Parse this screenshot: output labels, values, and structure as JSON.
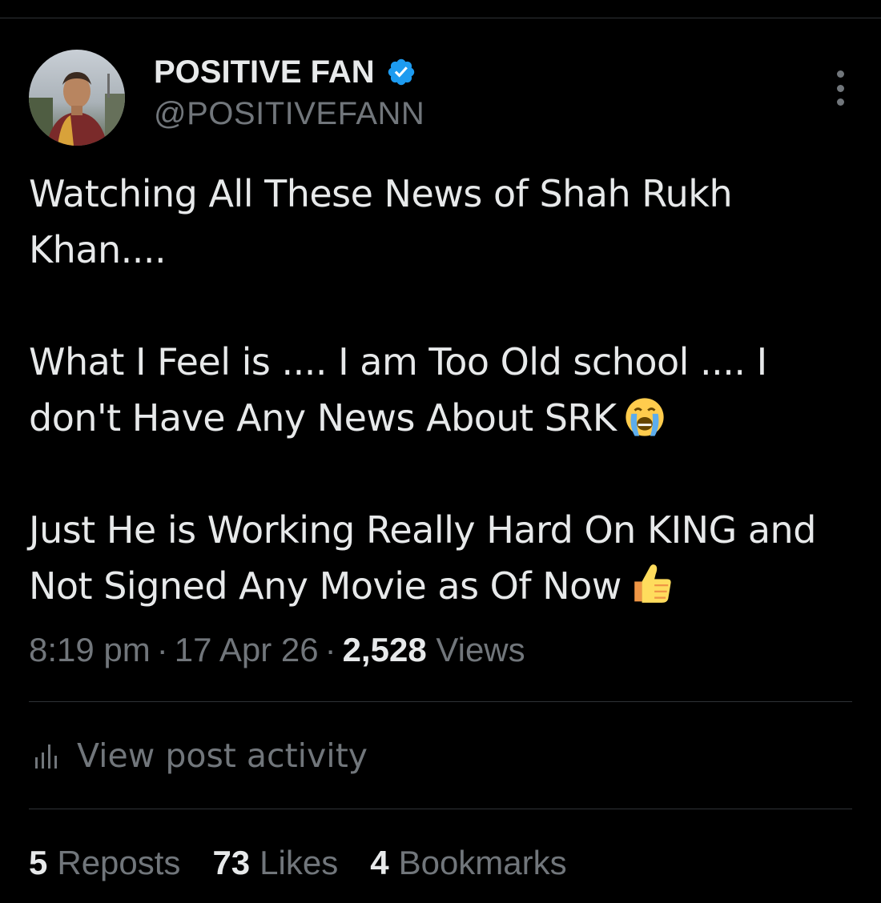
{
  "author": {
    "display_name": "POSITIVE FAN",
    "handle": "@POSITIVEFANN",
    "verified": true,
    "verified_color": "#1d9bf0"
  },
  "tweet": {
    "paragraphs": [
      {
        "text": "Watching All These News of Shah Rukh Khan....",
        "emoji": null
      },
      {
        "text": "What I Feel is .... I am Too Old school .... I don't Have Any News About SRK",
        "emoji": "loudly-crying-face"
      },
      {
        "text": "Just He is Working Really Hard On KING and Not Signed Any Movie as Of Now",
        "emoji": "thumbs-up"
      }
    ]
  },
  "meta": {
    "time": "8:19 pm",
    "date": "17 Apr 26",
    "separator": "·",
    "views_count": "2,528",
    "views_label": "Views"
  },
  "activity": {
    "label": "View post activity",
    "icon": "bar-chart-icon"
  },
  "stats": [
    {
      "count": "5",
      "label": "Reposts"
    },
    {
      "count": "73",
      "label": "Likes"
    },
    {
      "count": "4",
      "label": "Bookmarks"
    }
  ],
  "colors": {
    "background": "#000000",
    "text_primary": "#e7e9ea",
    "text_secondary": "#71767b",
    "divider": "#2f3336"
  }
}
